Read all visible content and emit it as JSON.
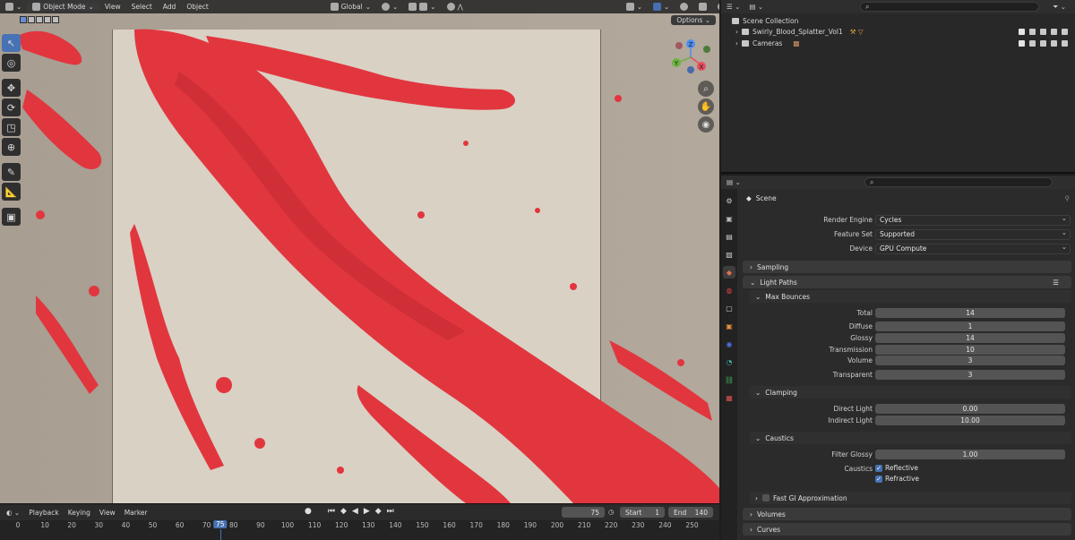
{
  "viewport": {
    "header": {
      "mode": "Object Mode",
      "menu": [
        "View",
        "Select",
        "Add",
        "Object"
      ],
      "orientation": "Global"
    },
    "options_label": "Options",
    "gizmo": {
      "x": "X",
      "y": "Y",
      "z": "Z"
    },
    "colors": {
      "splatter": "#e2363f",
      "background": "#d9d1c4"
    }
  },
  "timeline": {
    "menu": [
      "Playback",
      "Keying",
      "View",
      "Marker"
    ],
    "current_frame": "75",
    "start_label": "Start",
    "start_value": "1",
    "end_label": "End",
    "end_value": "140",
    "ticks": [
      "0",
      "10",
      "20",
      "30",
      "40",
      "50",
      "60",
      "70",
      "80",
      "90",
      "100",
      "110",
      "120",
      "130",
      "140",
      "150",
      "160",
      "170",
      "180",
      "190",
      "200",
      "210",
      "220",
      "230",
      "240",
      "250"
    ]
  },
  "outliner": {
    "root": "Scene Collection",
    "items": [
      {
        "name": "Swirly_Blood_Splatter_Vol1"
      },
      {
        "name": "Cameras"
      }
    ]
  },
  "properties": {
    "context": "Scene",
    "render_engine": {
      "label": "Render Engine",
      "value": "Cycles"
    },
    "feature_set": {
      "label": "Feature Set",
      "value": "Supported"
    },
    "device": {
      "label": "Device",
      "value": "GPU Compute"
    },
    "sections": {
      "sampling": "Sampling",
      "light_paths": "Light Paths",
      "max_bounces": "Max Bounces",
      "clamping": "Clamping",
      "caustics": "Caustics",
      "fast_gi": "Fast GI Approximation",
      "volumes": "Volumes",
      "curves": "Curves"
    },
    "bounces": [
      {
        "label": "Total",
        "value": "14"
      },
      {
        "label": "Diffuse",
        "value": "1"
      },
      {
        "label": "Glossy",
        "value": "14"
      },
      {
        "label": "Transmission",
        "value": "10"
      },
      {
        "label": "Volume",
        "value": "3"
      },
      {
        "label": "Transparent",
        "value": "3"
      }
    ],
    "clamping": [
      {
        "label": "Direct Light",
        "value": "0.00"
      },
      {
        "label": "Indirect Light",
        "value": "10.00"
      }
    ],
    "caustics": {
      "filter_glossy_label": "Filter Glossy",
      "filter_glossy_value": "1.00",
      "caustics_label": "Caustics",
      "reflective": "Reflective",
      "refractive": "Refractive"
    }
  }
}
